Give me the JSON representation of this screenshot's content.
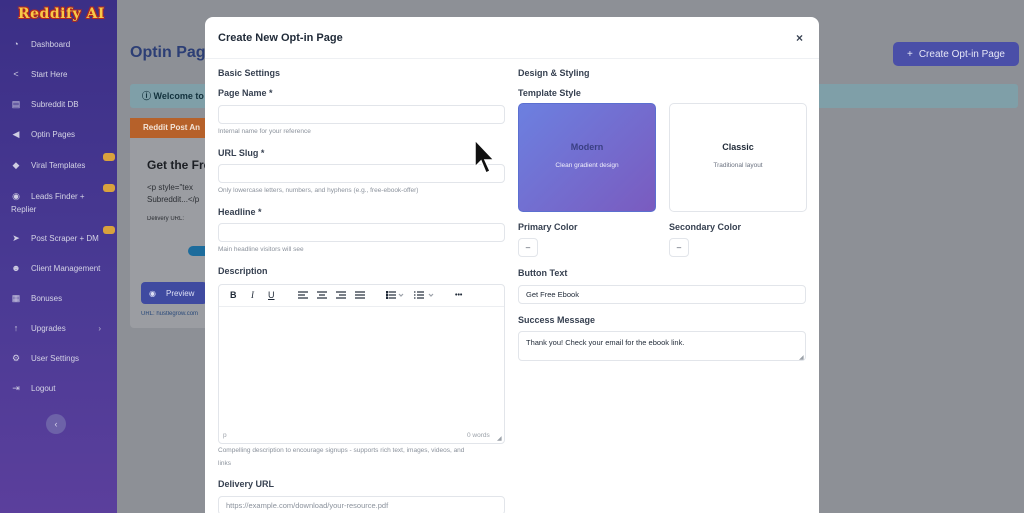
{
  "sidebar": {
    "logo": "Reddify AI",
    "items": [
      {
        "label": "Dashboard",
        "icon": "◔"
      },
      {
        "label": "Start Here",
        "icon": "<"
      },
      {
        "label": "Subreddit DB",
        "icon": "▤"
      },
      {
        "label": "Optin Pages",
        "icon": "◀"
      },
      {
        "label": "Viral Templates",
        "icon": "◆"
      },
      {
        "label": "Leads Finder +",
        "label2": "Replier",
        "icon": "◉"
      },
      {
        "label": "Post Scraper + DM",
        "icon": "➤"
      },
      {
        "label": "Client Management",
        "icon": "☻"
      },
      {
        "label": "Bonuses",
        "icon": "▦"
      },
      {
        "label": "Upgrades",
        "icon": "↑"
      },
      {
        "label": "User Settings",
        "icon": "⚙"
      },
      {
        "label": "Logout",
        "icon": "⇥"
      }
    ],
    "collapse_icon": "‹"
  },
  "background": {
    "page_title": "Optin Page",
    "create_button": "Create Opt-in Page",
    "create_icon": "+",
    "welcome_text": "Welcome to",
    "card": {
      "header": "Reddit Post An",
      "title": "Get the Fre",
      "code": "<p style=\"tex\nSubreddit...</p",
      "meta": "Delivery URL: ",
      "preview_button": "Preview",
      "url": "URL: hustlegrow.com"
    }
  },
  "modal": {
    "title": "Create New Opt-in Page",
    "close_icon": "×",
    "basic_settings": {
      "heading": "Basic Settings",
      "page_name": {
        "label": "Page Name *",
        "value": "",
        "hint": "Internal name for your reference"
      },
      "url_slug": {
        "label": "URL Slug *",
        "value": "",
        "hint": "Only lowercase letters, numbers, and hyphens (e.g., free-ebook-offer)"
      },
      "headline": {
        "label": "Headline *",
        "value": "",
        "hint": "Main headline visitors will see"
      },
      "description": {
        "label": "Description",
        "toolbar": {
          "bold": "B",
          "italic": "I",
          "underline": "U",
          "more": "•••"
        },
        "path": "p",
        "word_count": "0 words",
        "hint_line1": "Compelling description to encourage signups - supports rich text, images, videos, and",
        "hint_line2": "links"
      },
      "delivery_url": {
        "label": "Delivery URL",
        "placeholder": "https://example.com/download/your-resource.pdf"
      }
    },
    "design": {
      "heading": "Design & Styling",
      "template_style_label": "Template Style",
      "templates": [
        {
          "name": "Modern",
          "description": "Clean gradient design",
          "selected": true
        },
        {
          "name": "Classic",
          "description": "Traditional layout",
          "selected": false
        }
      ],
      "primary_color_label": "Primary Color",
      "primary_color_value": "–",
      "secondary_color_label": "Secondary Color",
      "secondary_color_value": "–",
      "button_text_label": "Button Text",
      "button_text_value": "Get Free Ebook",
      "success_message_label": "Success Message",
      "success_message_value": "Thank you! Check your email for the ebook link."
    }
  },
  "colors": {
    "sidebar": "#3b2f86",
    "accent": "#4a4fa8",
    "modern_template_start": "#6c80e0",
    "modern_template_end": "#7a5bbf"
  }
}
